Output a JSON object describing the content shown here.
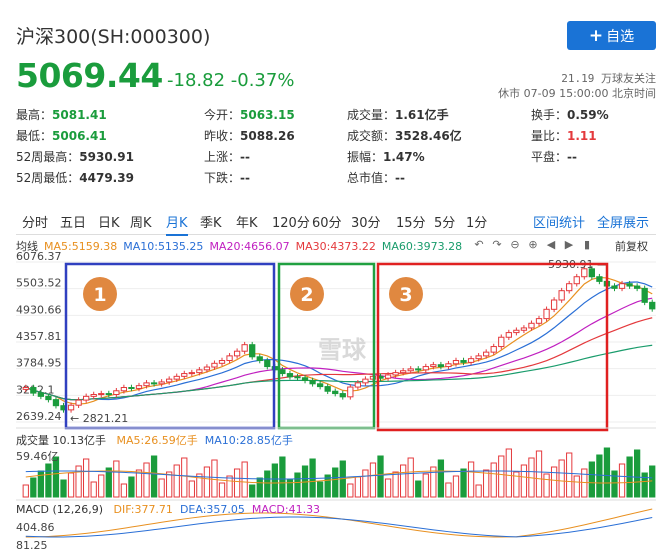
{
  "header": {
    "title": "沪深300(SH:000300)",
    "follow_label": "自选",
    "price": "5069.44",
    "change": "-18.82 -0.37%",
    "followers": "21.19 万球友关注",
    "status": "休市 07-09 15:00:00 北京时间"
  },
  "stats": [
    {
      "label": "最高：",
      "value": "5081.41",
      "cls": "green"
    },
    {
      "label": "今开：",
      "value": "5063.15",
      "cls": "green"
    },
    {
      "label": "成交量：",
      "value": "1.61亿手",
      "cls": ""
    },
    {
      "label": "换手：",
      "value": "0.59%",
      "cls": ""
    },
    {
      "label": "最低：",
      "value": "5006.41",
      "cls": "green"
    },
    {
      "label": "昨收：",
      "value": "5088.26",
      "cls": ""
    },
    {
      "label": "成交额：",
      "value": "3528.46亿",
      "cls": ""
    },
    {
      "label": "量比：",
      "value": "1.11",
      "cls": "red"
    },
    {
      "label": "52周最高：",
      "value": "5930.91",
      "cls": ""
    },
    {
      "label": "上涨：",
      "value": "--",
      "cls": ""
    },
    {
      "label": "振幅：",
      "value": "1.47%",
      "cls": ""
    },
    {
      "label": "平盘：",
      "value": "--",
      "cls": ""
    },
    {
      "label": "52周最低：",
      "value": "4479.39",
      "cls": ""
    },
    {
      "label": "下跌：",
      "value": "--",
      "cls": ""
    },
    {
      "label": "总市值：",
      "value": "--",
      "cls": ""
    }
  ],
  "tabs": [
    "分时",
    "五日",
    "日K",
    "周K",
    "月K",
    "季K",
    "年K",
    "120分",
    "60分",
    "30分",
    "15分",
    "5分",
    "1分"
  ],
  "active_tab": "月K",
  "tab_right": [
    "区间统计",
    "全屏展示"
  ],
  "ma": {
    "prefix": "均线",
    "items": [
      {
        "text": "MA5:5159.38",
        "color": "#e89020"
      },
      {
        "text": "MA10:5135.25",
        "color": "#2a6fd6"
      },
      {
        "text": "MA20:4656.07",
        "color": "#c020c0"
      },
      {
        "text": "MA30:4373.22",
        "color": "#e4393c"
      },
      {
        "text": "MA60:3973.28",
        "color": "#1a9c6c"
      }
    ]
  },
  "fq_label": "前复权",
  "y_ticks": [
    "6076.37",
    "5503.52",
    "4930.66",
    "4357.81",
    "3784.95",
    "3212.1",
    "2639.24"
  ],
  "annotations": {
    "high": "5930.91",
    "low": "2821.21"
  },
  "regions": [
    {
      "label": "1",
      "color": "#3040c0"
    },
    {
      "label": "2",
      "color": "#20a040"
    },
    {
      "label": "3",
      "color": "#e02020"
    }
  ],
  "watermark": "雪球",
  "volume": {
    "prefix": "成交量 10.13亿手",
    "ma5": "MA5:26.59亿手",
    "ma10": "MA10:28.85亿手",
    "ticks": [
      "59.46亿"
    ]
  },
  "macd": {
    "prefix": "MACD (12,26,9)",
    "dif": "DIF:377.71",
    "dea": "DEA:357.05",
    "macd": "MACD:41.33",
    "ticks": [
      "404.86",
      "81.25"
    ]
  },
  "chart_data": {
    "type": "candlestick",
    "ylim": [
      2639.24,
      6076.37
    ],
    "closes": [
      3380,
      3260,
      3190,
      3120,
      2990,
      2900,
      3000,
      3110,
      3190,
      3230,
      3250,
      3230,
      3310,
      3380,
      3360,
      3420,
      3480,
      3460,
      3500,
      3560,
      3620,
      3680,
      3700,
      3760,
      3820,
      3900,
      3960,
      4060,
      4160,
      4300,
      4040,
      3960,
      3830,
      3760,
      3680,
      3610,
      3590,
      3530,
      3460,
      3400,
      3300,
      3250,
      3180,
      3390,
      3480,
      3560,
      3620,
      3580,
      3650,
      3700,
      3740,
      3780,
      3760,
      3830,
      3870,
      3830,
      3890,
      3960,
      3920,
      4000,
      4060,
      4140,
      4260,
      4460,
      4560,
      4610,
      4660,
      4760,
      4860,
      5060,
      5260,
      5460,
      5610,
      5760,
      5930,
      5760,
      5660,
      5560,
      5510,
      5610,
      5560,
      5510,
      5210,
      5069
    ]
  }
}
